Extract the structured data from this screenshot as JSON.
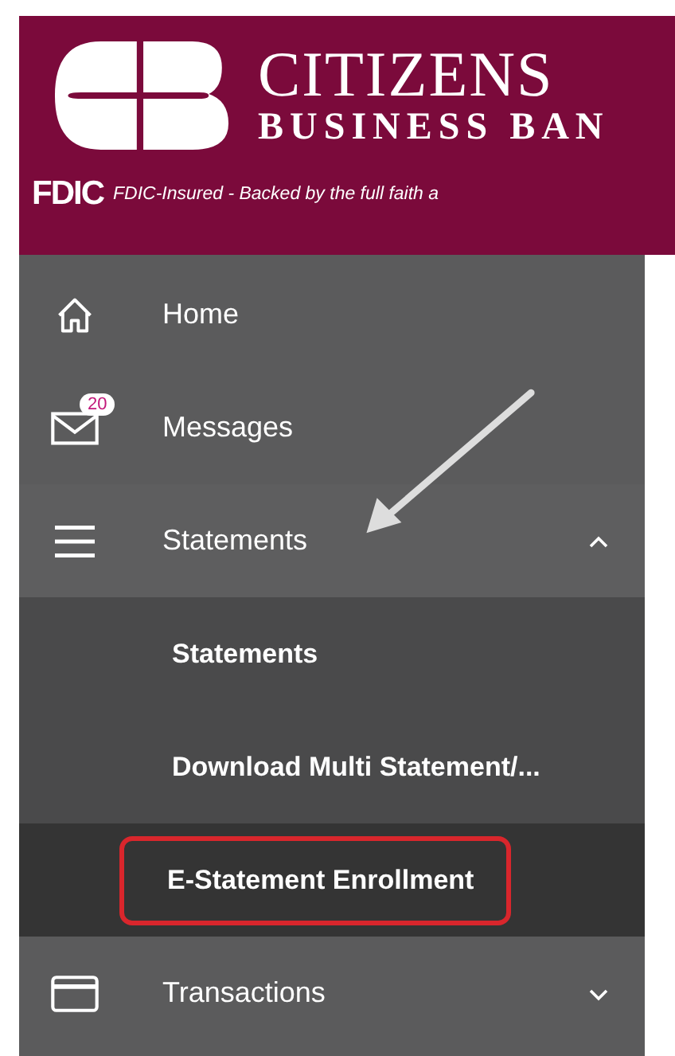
{
  "header": {
    "bank_name": "CITIZENS",
    "bank_subname": "BUSINESS BAN",
    "fdic_mark": "FDIC",
    "fdic_text": "FDIC-Insured - Backed by the full faith a"
  },
  "sidebar": {
    "items": [
      {
        "kind": "home",
        "label": "Home"
      },
      {
        "kind": "messages",
        "label": "Messages",
        "badge": "20"
      },
      {
        "kind": "statements",
        "label": "Statements",
        "expanded": true,
        "children": [
          {
            "label": "Statements",
            "selected": false,
            "highlighted": false
          },
          {
            "label": "Download Multi Statement/...",
            "selected": false,
            "highlighted": false
          },
          {
            "label": "E-Statement Enrollment",
            "selected": true,
            "highlighted": true
          }
        ]
      },
      {
        "kind": "transactions",
        "label": "Transactions",
        "expanded": false
      }
    ]
  },
  "annotations": [
    {
      "kind": "arrow"
    }
  ]
}
